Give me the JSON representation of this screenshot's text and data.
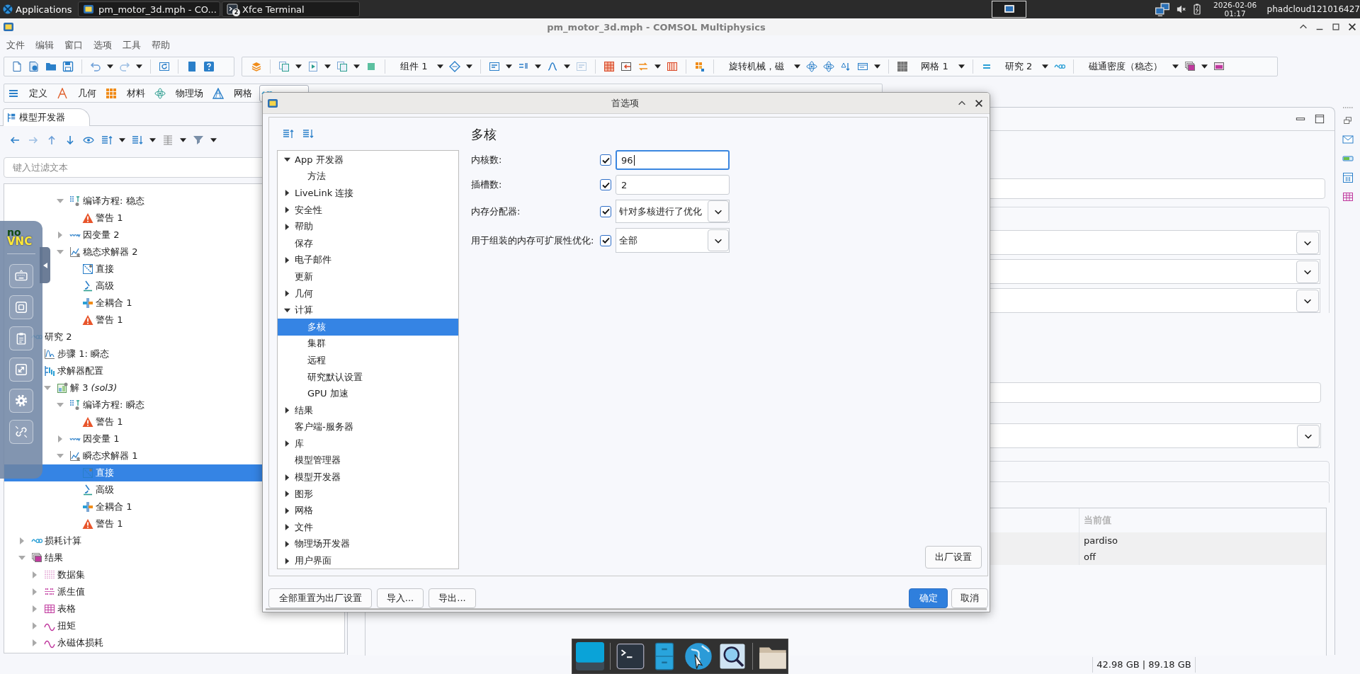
{
  "taskbar": {
    "menu": "Applications",
    "windows": [
      {
        "title": "pm_motor_3d.mph - CO..."
      },
      {
        "title": "Xfce Terminal",
        "count": "2"
      }
    ],
    "date": "2026-02-06",
    "time": "01:17",
    "user": "phadcloud121016427"
  },
  "window": {
    "title": "pm_motor_3d.mph - COMSOL Multiphysics"
  },
  "menu": [
    "文件",
    "编辑",
    "窗口",
    "选项",
    "工具",
    "帮助"
  ],
  "toolbar": {
    "selectors": [
      "组件 1",
      "旋转机械，磁",
      "网格 1",
      "研究 2",
      "磁通密度（稳态）"
    ]
  },
  "ribbon": {
    "tabs": [
      {
        "kind": "definitions",
        "label": "定义",
        "selected": false
      },
      {
        "kind": "geometry",
        "label": "几何",
        "selected": false
      },
      {
        "kind": "materials",
        "label": "材料",
        "selected": false
      },
      {
        "kind": "physics",
        "label": "物理场",
        "selected": false
      },
      {
        "kind": "mesh",
        "label": "网格",
        "selected": false
      },
      {
        "kind": "study",
        "selected": true
      }
    ]
  },
  "model_builder": {
    "tab": "模型开发器",
    "filter": {
      "placeholder": "键入过滤文本"
    },
    "scrolled_branch": [
      {
        "label": "编译方程: 稳态",
        "kind": "equations",
        "selected": false,
        "expanded": true,
        "children": [
          {
            "label": "警告 1",
            "kind": "warning",
            "selected": false
          }
        ]
      },
      {
        "label": "因变量 2",
        "kind": "variables",
        "selected": false,
        "expanded": false
      },
      {
        "label": "稳态求解器 2",
        "kind": "solver",
        "selected": false,
        "expanded": true,
        "children": [
          {
            "label": "直接",
            "kind": "direct",
            "selected": false
          },
          {
            "label": "高级",
            "kind": "advanced",
            "selected": false
          },
          {
            "label": "全耦合 1",
            "kind": "coupled",
            "selected": false
          },
          {
            "label": "警告 1",
            "kind": "warning",
            "selected": false
          }
        ]
      }
    ],
    "tree": [
      {
        "label": "研究 2",
        "kind": "study",
        "selected": false,
        "children": [
          {
            "label": "步骤 1: 瞬态",
            "kind": "step",
            "selected": false
          },
          {
            "label": "求解器配置",
            "kind": "config",
            "selected": false,
            "children": [
              {
                "label": "解 3 *(sol3)*",
                "kind": "solution",
                "selected": false,
                "expanded": true,
                "children": [
                  {
                    "label": "编译方程: 瞬态",
                    "kind": "equations",
                    "selected": false,
                    "expanded": true,
                    "children": [
                      {
                        "label": "警告 1",
                        "kind": "warning",
                        "selected": false
                      }
                    ]
                  },
                  {
                    "label": "因变量 1",
                    "kind": "variables",
                    "selected": false,
                    "expanded": false
                  },
                  {
                    "label": "瞬态求解器 1",
                    "kind": "solver",
                    "selected": false,
                    "expanded": true,
                    "children": [
                      {
                        "label": "直接",
                        "kind": "direct",
                        "selected": true
                      },
                      {
                        "label": "高级",
                        "kind": "advanced",
                        "selected": false
                      },
                      {
                        "label": "全耦合 1",
                        "kind": "coupled",
                        "selected": false
                      },
                      {
                        "label": "警告 1",
                        "kind": "warning",
                        "selected": false
                      }
                    ]
                  }
                ]
              }
            ]
          }
        ]
      },
      {
        "label": "损耗计算",
        "kind": "study",
        "selected": false,
        "expanded": false
      },
      {
        "label": "结果",
        "kind": "results",
        "selected": false,
        "expanded": true,
        "children": [
          {
            "label": "数据集",
            "kind": "dataset",
            "selected": false,
            "expanded": false
          },
          {
            "label": "派生值",
            "kind": "derived",
            "selected": false,
            "expanded": false
          },
          {
            "label": "表格",
            "kind": "table",
            "selected": false,
            "expanded": false
          },
          {
            "label": "扭矩",
            "kind": "plot",
            "selected": false,
            "expanded": false
          },
          {
            "label": "永磁体损耗",
            "kind": "plot",
            "selected": false,
            "expanded": false
          }
        ]
      }
    ]
  },
  "vnc_panel": {
    "logo": [
      "no",
      "VNC"
    ]
  },
  "settings": {
    "table": {
      "header": "当前值",
      "cells": [
        "pardiso",
        "off"
      ]
    }
  },
  "status": {
    "memory": "42.98 GB | 89.18 GB"
  },
  "dialog": {
    "title": "首选项",
    "tree": [
      {
        "label": "App 开发器",
        "selected": false,
        "expanded": true,
        "children": [
          {
            "label": "方法",
            "selected": false
          }
        ]
      },
      {
        "label": "LiveLink 连接",
        "selected": false,
        "expanded": false
      },
      {
        "label": "安全性",
        "selected": false,
        "expanded": false
      },
      {
        "label": "帮助",
        "selected": false,
        "expanded": false
      },
      {
        "label": "保存",
        "selected": false
      },
      {
        "label": "电子邮件",
        "selected": false,
        "expanded": false
      },
      {
        "label": "更新",
        "selected": false
      },
      {
        "label": "几何",
        "selected": false,
        "expanded": false
      },
      {
        "label": "计算",
        "selected": false,
        "expanded": true,
        "children": [
          {
            "label": "多核",
            "selected": true
          },
          {
            "label": "集群",
            "selected": false
          },
          {
            "label": "远程",
            "selected": false
          },
          {
            "label": "研究默认设置",
            "selected": false
          },
          {
            "label": "GPU 加速",
            "selected": false
          }
        ]
      },
      {
        "label": "结果",
        "selected": false,
        "expanded": false
      },
      {
        "label": "客户端-服务器",
        "selected": false
      },
      {
        "label": "库",
        "selected": false,
        "expanded": false
      },
      {
        "label": "模型管理器",
        "selected": false
      },
      {
        "label": "模型开发器",
        "selected": false,
        "expanded": false
      },
      {
        "label": "图形",
        "selected": false,
        "expanded": false
      },
      {
        "label": "网格",
        "selected": false,
        "expanded": false
      },
      {
        "label": "文件",
        "selected": false,
        "expanded": false
      },
      {
        "label": "物理场开发器",
        "selected": false,
        "expanded": false
      },
      {
        "label": "用户界面",
        "selected": false,
        "expanded": false
      }
    ],
    "page_title": "多核",
    "fields": [
      {
        "label": "内核数:",
        "checked": true,
        "kind": "input",
        "value": "96",
        "focused": true
      },
      {
        "label": "插槽数:",
        "checked": true,
        "kind": "input",
        "value": "2",
        "focused": false
      },
      {
        "label": "内存分配器:",
        "checked": true,
        "kind": "combo",
        "value": "针对多核进行了优化",
        "focused": false
      },
      {
        "label": "用于组装的内存可扩展性优化:",
        "checked": true,
        "kind": "combo",
        "value": "全部",
        "focused": false
      }
    ],
    "restore_button": "出厂设置",
    "footer_buttons": [
      "全部重置为出厂设置",
      "导入...",
      "导出..."
    ],
    "ok_button": "确定",
    "cancel_button": "取消"
  }
}
